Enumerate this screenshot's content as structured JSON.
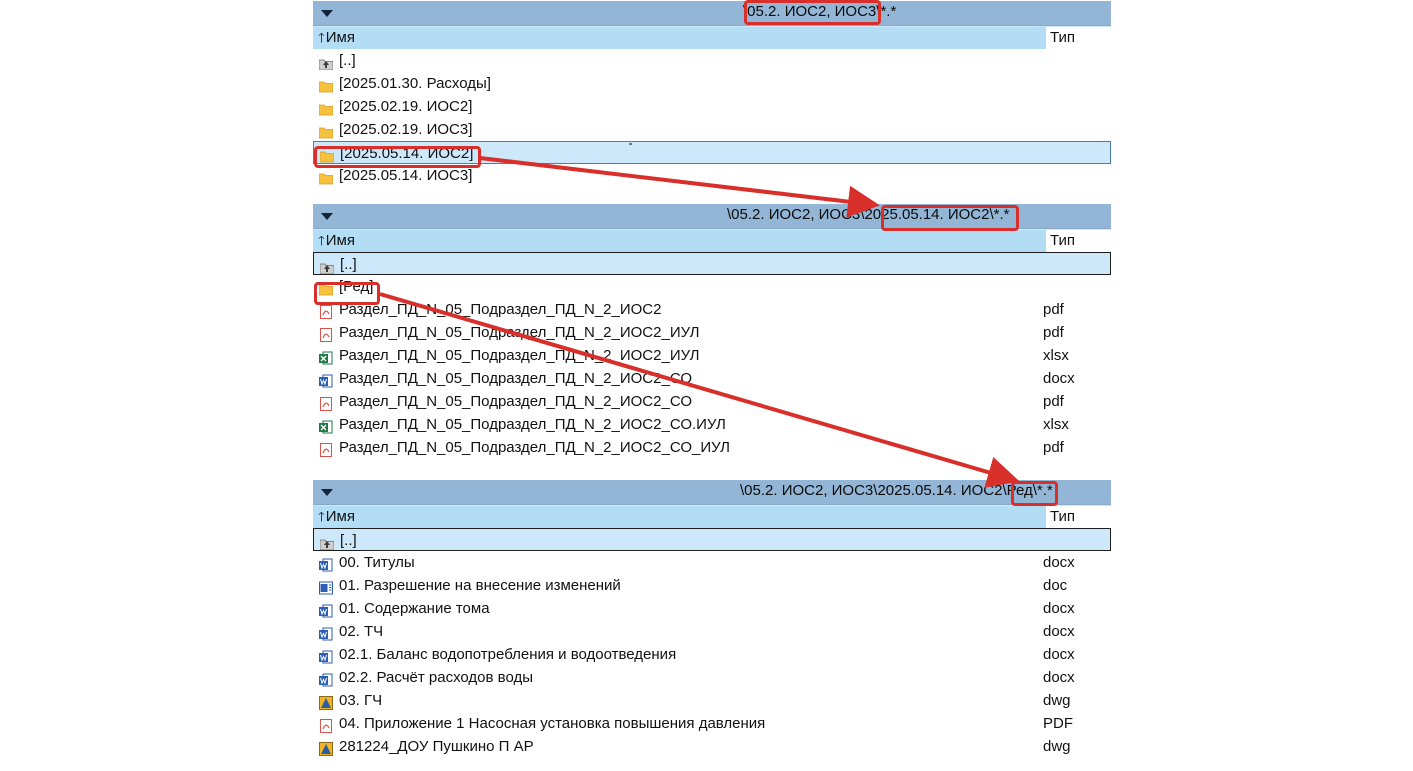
{
  "colors": {
    "path_bar": "#93b6d6",
    "header": "#b3dcf5",
    "annotation": "#d92f2a"
  },
  "panels": [
    {
      "path": "\\05.2. ИОС2, ИОС3\\*.*",
      "col_name": "Имя",
      "col_type": "Тип",
      "rows": [
        {
          "icon": "up-folder-icon",
          "label": "[..]",
          "type": ""
        },
        {
          "icon": "folder-icon",
          "label": "[2025.01.30. Расходы]",
          "type": ""
        },
        {
          "icon": "folder-icon",
          "label": "[2025.02.19. ИОС2]",
          "type": ""
        },
        {
          "icon": "folder-icon",
          "label": "[2025.02.19. ИОС3]",
          "type": ""
        },
        {
          "icon": "folder-icon",
          "label": "[2025.05.14. ИОС2]",
          "type": ""
        },
        {
          "icon": "folder-icon",
          "label": "[2025.05.14. ИОС3]",
          "type": ""
        }
      ]
    },
    {
      "path": "\\05.2. ИОС2, ИОС3\\2025.05.14. ИОС2\\*.*",
      "col_name": "Имя",
      "col_type": "Тип",
      "rows": [
        {
          "icon": "up-folder-icon",
          "label": "[..]",
          "type": ""
        },
        {
          "icon": "folder-icon",
          "label": "[Ред]",
          "type": ""
        },
        {
          "icon": "pdf-icon",
          "label": "Раздел_ПД_N_05_Подраздел_ПД_N_2_ИОС2",
          "type": "pdf"
        },
        {
          "icon": "pdf-icon",
          "label": "Раздел_ПД_N_05_Подраздел_ПД_N_2_ИОС2_ИУЛ",
          "type": "pdf"
        },
        {
          "icon": "excel-icon",
          "label": "Раздел_ПД_N_05_Подраздел_ПД_N_2_ИОС2_ИУЛ",
          "type": "xlsx"
        },
        {
          "icon": "word-icon",
          "label": "Раздел_ПД_N_05_Подраздел_ПД_N_2_ИОС2_СО",
          "type": "docx"
        },
        {
          "icon": "pdf-icon",
          "label": "Раздел_ПД_N_05_Подраздел_ПД_N_2_ИОС2_СО",
          "type": "pdf"
        },
        {
          "icon": "excel-icon",
          "label": "Раздел_ПД_N_05_Подраздел_ПД_N_2_ИОС2_СО.ИУЛ",
          "type": "xlsx"
        },
        {
          "icon": "pdf-icon",
          "label": "Раздел_ПД_N_05_Подраздел_ПД_N_2_ИОС2_СО_ИУЛ",
          "type": "pdf"
        }
      ]
    },
    {
      "path": "\\05.2. ИОС2, ИОС3\\2025.05.14. ИОС2\\Ред\\*.*",
      "col_name": "Имя",
      "col_type": "Тип",
      "rows": [
        {
          "icon": "up-folder-icon",
          "label": "[..]",
          "type": ""
        },
        {
          "icon": "word-icon",
          "label": "00. Титулы",
          "type": "docx"
        },
        {
          "icon": "word-doc-icon",
          "label": "01. Разрешение на внесение изменений",
          "type": "doc"
        },
        {
          "icon": "word-icon",
          "label": "01. Содержание тома",
          "type": "docx"
        },
        {
          "icon": "word-icon",
          "label": "02. ТЧ",
          "type": "docx"
        },
        {
          "icon": "word-icon",
          "label": "02.1. Баланс водопотребления и водоотведения",
          "type": "docx"
        },
        {
          "icon": "word-icon",
          "label": "02.2. Расчёт расходов воды",
          "type": "docx"
        },
        {
          "icon": "dwg-icon",
          "label": "03. ГЧ",
          "type": "dwg"
        },
        {
          "icon": "pdf-icon",
          "label": "04. Приложение 1 Насосная установка повышения давления",
          "type": "PDF"
        },
        {
          "icon": "dwg-icon",
          "label": "281224_ДОУ Пушкино П АР",
          "type": "dwg"
        }
      ]
    }
  ]
}
